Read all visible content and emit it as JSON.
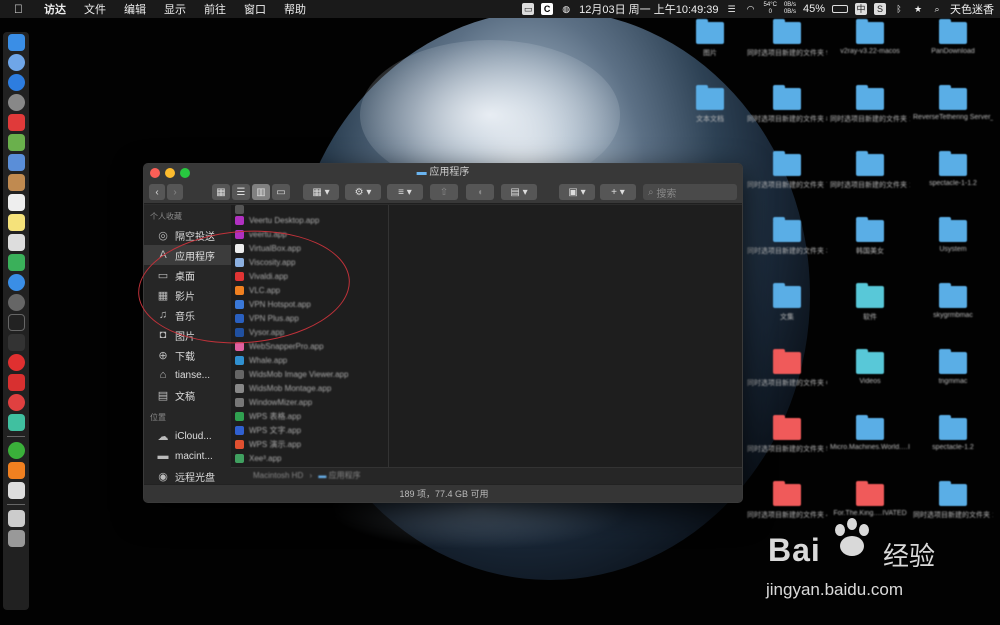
{
  "menubar": {
    "app": "访达",
    "menus": [
      "文件",
      "编辑",
      "显示",
      "前往",
      "窗口",
      "帮助"
    ],
    "datetime": "12月03日 周一 上午10:49:39",
    "temp_top": "54°C",
    "temp_bottom": "0",
    "net_up": "0B/s",
    "net_down": "0B/s",
    "battery": "45%",
    "input": "中",
    "user": "天色迷香"
  },
  "finder": {
    "title": "应用程序",
    "search_placeholder": "搜索",
    "sidebar": {
      "favorites_header": "个人收藏",
      "favorites": [
        {
          "label": "隔空投送",
          "icon": "airdrop-icon",
          "glyph": "◎"
        },
        {
          "label": "应用程序",
          "icon": "applications-icon",
          "glyph": "A",
          "selected": true
        },
        {
          "label": "桌面",
          "icon": "desktop-icon",
          "glyph": "▭"
        },
        {
          "label": "影片",
          "icon": "movies-icon",
          "glyph": "▦"
        },
        {
          "label": "音乐",
          "icon": "music-icon",
          "glyph": "♫"
        },
        {
          "label": "图片",
          "icon": "pictures-icon",
          "glyph": "◘"
        },
        {
          "label": "下载",
          "icon": "downloads-icon",
          "glyph": "⊕"
        },
        {
          "label": "tianse...",
          "icon": "home-icon",
          "glyph": "⌂"
        },
        {
          "label": "文稿",
          "icon": "documents-icon",
          "glyph": "▤"
        }
      ],
      "locations_header": "位置",
      "locations": [
        {
          "label": "iCloud...",
          "icon": "cloud-icon",
          "glyph": "☁"
        },
        {
          "label": "macint...",
          "icon": "disk-icon",
          "glyph": "▬"
        },
        {
          "label": "远程光盘",
          "icon": "remote-disc-icon",
          "glyph": "◉"
        }
      ]
    },
    "files": [
      {
        "name": "",
        "color": "#555"
      },
      {
        "name": "Veertu Desktop.app",
        "color": "#b030c0"
      },
      {
        "name": "veertu.app",
        "color": "#b030c0"
      },
      {
        "name": "VirtualBox.app",
        "color": "#eee"
      },
      {
        "name": "Viscosity.app",
        "color": "#8cb0e0"
      },
      {
        "name": "Vivaldi.app",
        "color": "#e03434"
      },
      {
        "name": "VLC.app",
        "color": "#f08020"
      },
      {
        "name": "VPN Hotspot.app",
        "color": "#3a78d8"
      },
      {
        "name": "VPN Plus.app",
        "color": "#2a60c0"
      },
      {
        "name": "Vysor.app",
        "color": "#2050a0"
      },
      {
        "name": "WebSnapperPro.app",
        "color": "#e060a0"
      },
      {
        "name": "Whale.app",
        "color": "#3090d0"
      },
      {
        "name": "WidsMob Image Viewer.app",
        "color": "#666"
      },
      {
        "name": "WidsMob Montage.app",
        "color": "#888"
      },
      {
        "name": "WindowMizer.app",
        "color": "#777"
      },
      {
        "name": "WPS 表格.app",
        "color": "#30a050"
      },
      {
        "name": "WPS 文字.app",
        "color": "#3060d0"
      },
      {
        "name": "WPS 演示.app",
        "color": "#e05030"
      },
      {
        "name": "Xee³.app",
        "color": "#40a060"
      }
    ],
    "path": [
      "Macintosh HD",
      "应用程序"
    ],
    "status": "189 项，77.4 GB 可用"
  },
  "desktop_icons": [
    {
      "label": "图片",
      "color": "blue"
    },
    {
      "label": "同时选项目新建的文件夹 9",
      "color": "blue"
    },
    {
      "label": "v2ray-v3.22-macos",
      "color": "blue"
    },
    {
      "label": "PanDownload",
      "color": "blue"
    },
    {
      "label": "文本文档",
      "color": "blue"
    },
    {
      "label": "同时选项目新建的文件夹 8",
      "color": "blue"
    },
    {
      "label": "同时选项目新建的文件夹 13",
      "color": "blue"
    },
    {
      "label": "ReverseTethering Server_1.2.0",
      "color": "blue"
    },
    {
      "label": "同时选项目新建的文件夹 7",
      "color": "blue"
    },
    {
      "label": "同时选项目新建的文件夹 12",
      "color": "blue"
    },
    {
      "label": "spectacle-1-1.2",
      "color": "blue"
    },
    {
      "label": "同时选项目新建的文件夹 3",
      "color": "blue"
    },
    {
      "label": "韩国美女",
      "color": "blue"
    },
    {
      "label": "Usystem",
      "color": "blue"
    },
    {
      "label": "文集",
      "color": "blue"
    },
    {
      "label": "软件",
      "color": "teal"
    },
    {
      "label": "skygrmbmac",
      "color": "blue"
    },
    {
      "label": "同时选项目新建的文件夹 6",
      "color": "red"
    },
    {
      "label": "Videos",
      "color": "teal"
    },
    {
      "label": "tngmmac",
      "color": "blue"
    },
    {
      "label": "同时选项目新建的文件夹 5",
      "color": "red"
    },
    {
      "label": "Micro.Machines.World.…IVATED",
      "color": "blue"
    },
    {
      "label": "spectacle-1.2",
      "color": "blue"
    },
    {
      "label": "同时选项目新建的文件夹 4",
      "color": "red"
    },
    {
      "label": "For.The.King.…IVATED",
      "color": "red"
    },
    {
      "label": "同时选项目新建的文件夹 14",
      "color": "blue"
    }
  ],
  "watermark": {
    "logo": "Bai",
    "logo_suffix": "经验",
    "url": "jingyan.baidu.com"
  },
  "colors": {
    "annotation": "#c0323a",
    "selection": "#3c3c3c"
  }
}
